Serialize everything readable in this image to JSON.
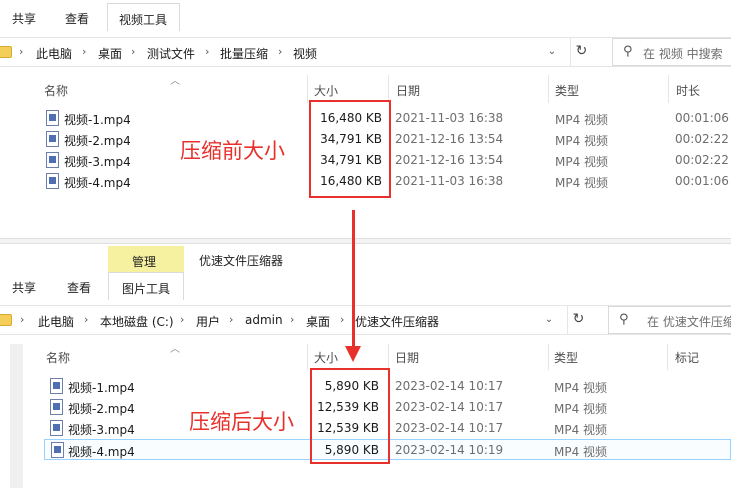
{
  "top": {
    "ribbon": {
      "tab_share": "共享",
      "tab_view": "查看",
      "tab_video_tools": "视频工具"
    },
    "breadcrumb": [
      "此电脑",
      "桌面",
      "测试文件",
      "批量压缩",
      "视频"
    ],
    "search_placeholder": "在 视频 中搜索",
    "columns": {
      "name": "名称",
      "size": "大小",
      "date": "日期",
      "type": "类型",
      "duration": "时长"
    },
    "files": [
      {
        "name": "视频-1.mp4",
        "size": "16,480 KB",
        "date": "2021-11-03 16:38",
        "type": "MP4 视频",
        "duration": "00:01:06"
      },
      {
        "name": "视频-2.mp4",
        "size": "34,791 KB",
        "date": "2021-12-16 13:54",
        "type": "MP4 视频",
        "duration": "00:02:22"
      },
      {
        "name": "视频-3.mp4",
        "size": "34,791 KB",
        "date": "2021-12-16 13:54",
        "type": "MP4 视频",
        "duration": "00:02:22"
      },
      {
        "name": "视频-4.mp4",
        "size": "16,480 KB",
        "date": "2021-11-03 16:38",
        "type": "MP4 视频",
        "duration": "00:01:06"
      }
    ],
    "annotation": "压缩前大小"
  },
  "bottom": {
    "ribbon": {
      "tab_manage": "管理",
      "window_title": "优速文件压缩器",
      "tab_share": "共享",
      "tab_view": "查看",
      "tab_picture_tools": "图片工具"
    },
    "breadcrumb": [
      "此电脑",
      "本地磁盘 (C:)",
      "用户",
      "admin",
      "桌面",
      "优速文件压缩器"
    ],
    "search_placeholder": "在 优速文件压缩",
    "columns": {
      "name": "名称",
      "size": "大小",
      "date": "日期",
      "type": "类型",
      "tags": "标记"
    },
    "files": [
      {
        "name": "视频-1.mp4",
        "size": "5,890 KB",
        "date": "2023-02-14 10:17",
        "type": "MP4 视频"
      },
      {
        "name": "视频-2.mp4",
        "size": "12,539 KB",
        "date": "2023-02-14 10:17",
        "type": "MP4 视频"
      },
      {
        "name": "视频-3.mp4",
        "size": "12,539 KB",
        "date": "2023-02-14 10:17",
        "type": "MP4 视频"
      },
      {
        "name": "视频-4.mp4",
        "size": "5,890 KB",
        "date": "2023-02-14 10:19",
        "type": "MP4 视频"
      }
    ],
    "annotation": "压缩后大小"
  },
  "colors": {
    "annotation_red": "#e8312c",
    "manage_tab_bg": "#f6f1a0",
    "selected_row_border": "#99d1ff"
  },
  "icons": {
    "folder": "folder-icon",
    "file": "video-file-icon",
    "search": "search-icon",
    "refresh": "refresh-icon",
    "chevron": "chevron-right-icon"
  }
}
